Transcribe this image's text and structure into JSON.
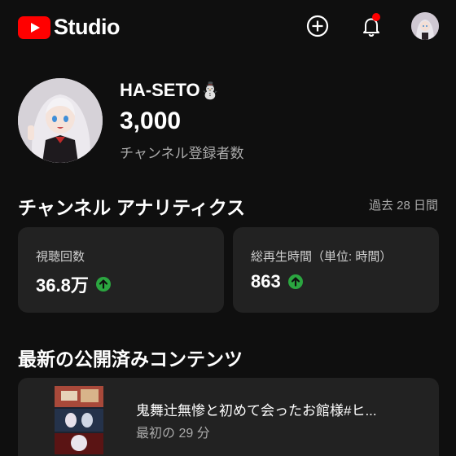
{
  "header": {
    "logo_text": "Studio",
    "brand_color": "#ff0000",
    "create_icon": "add-circle-icon",
    "notification_icon": "bell-icon",
    "has_notification": true
  },
  "channel": {
    "name": "HA-SETO",
    "name_emoji": "⛄",
    "subscriber_count": "3,000",
    "subscriber_label": "チャンネル登録者数"
  },
  "analytics": {
    "title": "チャンネル アナリティクス",
    "period": "過去 28 日間",
    "metrics": [
      {
        "label": "視聴回数",
        "value": "36.8万",
        "trend": "up"
      },
      {
        "label": "総再生時間（単位: 時間）",
        "value": "863",
        "trend": "up"
      }
    ],
    "trend_color": "#2ba640"
  },
  "latest": {
    "title": "最新の公開済みコンテンツ",
    "video_title": "鬼舞辻無惨と初めて会ったお館様#ヒ...",
    "video_sub": "最初の 29 分"
  }
}
